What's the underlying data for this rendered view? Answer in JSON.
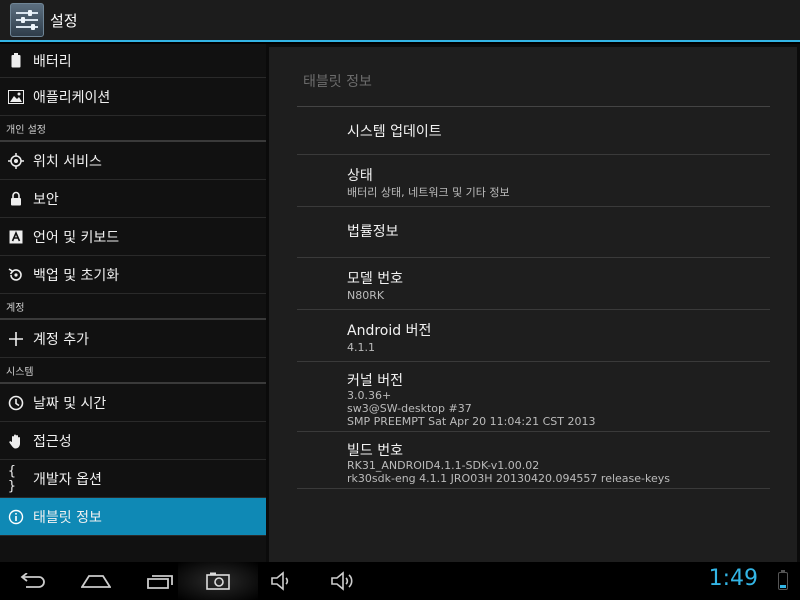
{
  "action_bar": {
    "title": "설정",
    "icon": "settings-sliders-icon"
  },
  "sidebar": {
    "top_items": [
      {
        "label": "배터리",
        "icon": "battery-icon"
      },
      {
        "label": "애플리케이션",
        "icon": "applications-icon"
      }
    ],
    "sections": [
      {
        "header": "개인 설정",
        "items": [
          {
            "label": "위치 서비스",
            "icon": "location-icon"
          },
          {
            "label": "보안",
            "icon": "lock-icon"
          },
          {
            "label": "언어 및 키보드",
            "icon": "language-icon"
          },
          {
            "label": "백업 및 초기화",
            "icon": "backup-icon"
          }
        ]
      },
      {
        "header": "계정",
        "items": [
          {
            "label": "계정 추가",
            "icon": "add-icon"
          }
        ]
      },
      {
        "header": "시스템",
        "items": [
          {
            "label": "날짜 및 시간",
            "icon": "clock-icon"
          },
          {
            "label": "접근성",
            "icon": "hand-icon"
          },
          {
            "label": "개발자 옵션",
            "icon": "braces-icon"
          },
          {
            "label": "태블릿 정보",
            "icon": "info-icon",
            "selected": true
          }
        ]
      }
    ]
  },
  "detail": {
    "title": "태블릿 정보",
    "rows": [
      {
        "heading": "시스템 업데이트",
        "lines": []
      },
      {
        "heading": "상태",
        "lines": [
          "배터리 상태, 네트워크 및 기타 정보"
        ]
      },
      {
        "heading": "법률정보",
        "lines": []
      },
      {
        "heading": "모델 번호",
        "lines": [
          "N80RK"
        ]
      },
      {
        "heading": "Android 버전",
        "lines": [
          "4.1.1"
        ]
      },
      {
        "heading": "커널 버전",
        "lines": [
          "3.0.36+",
          "sw3@SW-desktop #37",
          "SMP PREEMPT Sat Apr 20 11:04:21 CST 2013"
        ]
      },
      {
        "heading": "빌드 번호",
        "lines": [
          "RK31_ANDROID4.1.1-SDK-v1.00.02",
          "rk30sdk-eng 4.1.1 JRO03H 20130420.094557 release-keys"
        ]
      }
    ]
  },
  "navbar": {
    "buttons": [
      "back-icon",
      "home-icon",
      "recent-apps-icon",
      "screenshot-icon",
      "volume-down-icon",
      "volume-up-icon"
    ],
    "clock": "1:49",
    "battery_level": 0.2
  },
  "colors": {
    "accent": "#33b5e5",
    "selected": "#0f89b5"
  }
}
